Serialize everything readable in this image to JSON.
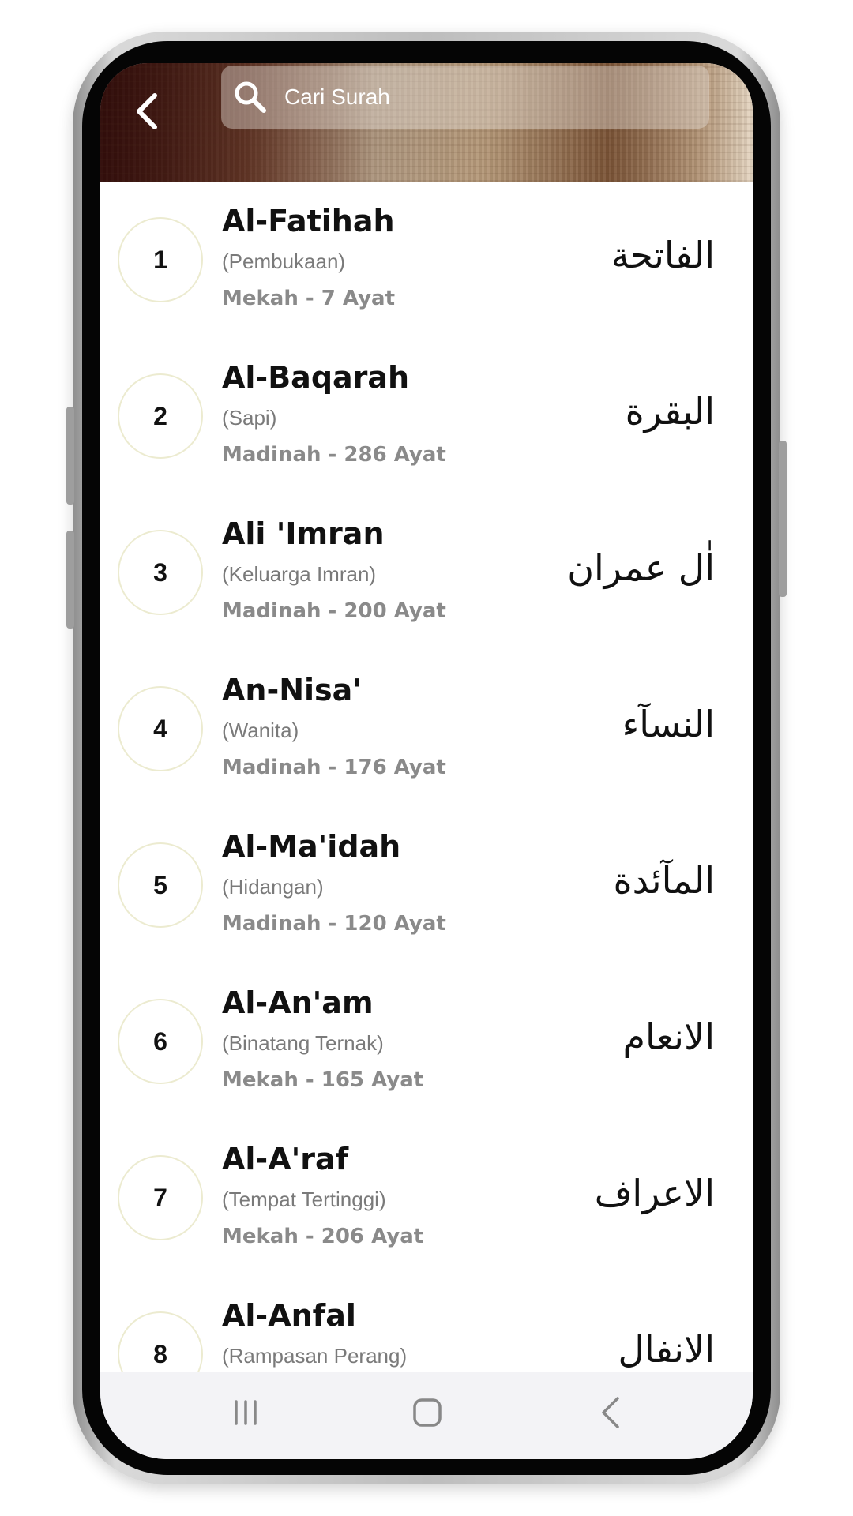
{
  "header": {
    "back_icon": "chevron-left-icon",
    "search_icon": "search-icon",
    "search_placeholder": "Cari Surah"
  },
  "surahs": [
    {
      "number": "1",
      "name": "Al-Fatihah",
      "meaning": "(Pembukaan)",
      "info": "Mekah - 7 Ayat",
      "arabic": "الفاتحة"
    },
    {
      "number": "2",
      "name": "Al-Baqarah",
      "meaning": "(Sapi)",
      "info": "Madinah - 286 Ayat",
      "arabic": "البقرة"
    },
    {
      "number": "3",
      "name": "Ali 'Imran",
      "meaning": "(Keluarga Imran)",
      "info": "Madinah - 200 Ayat",
      "arabic": "اٰل عمران"
    },
    {
      "number": "4",
      "name": "An-Nisa'",
      "meaning": "(Wanita)",
      "info": "Madinah - 176 Ayat",
      "arabic": "النسآء"
    },
    {
      "number": "5",
      "name": "Al-Ma'idah",
      "meaning": "(Hidangan)",
      "info": "Madinah - 120 Ayat",
      "arabic": "المآئدة"
    },
    {
      "number": "6",
      "name": "Al-An'am",
      "meaning": "(Binatang Ternak)",
      "info": "Mekah - 165 Ayat",
      "arabic": "الانعام"
    },
    {
      "number": "7",
      "name": "Al-A'raf",
      "meaning": "(Tempat Tertinggi)",
      "info": "Mekah - 206 Ayat",
      "arabic": "الاعراف"
    },
    {
      "number": "8",
      "name": "Al-Anfal",
      "meaning": "(Rampasan Perang)",
      "info": "",
      "arabic": "الانفال"
    }
  ],
  "navbar": {
    "recent_icon": "recent-apps-icon",
    "home_icon": "home-icon",
    "back_icon": "back-icon"
  },
  "colors": {
    "circle_border": "#ecebd0",
    "meaning_text": "#7a7a7a",
    "info_text": "#8a8a8a",
    "navbar_bg": "#f3f3f6"
  }
}
